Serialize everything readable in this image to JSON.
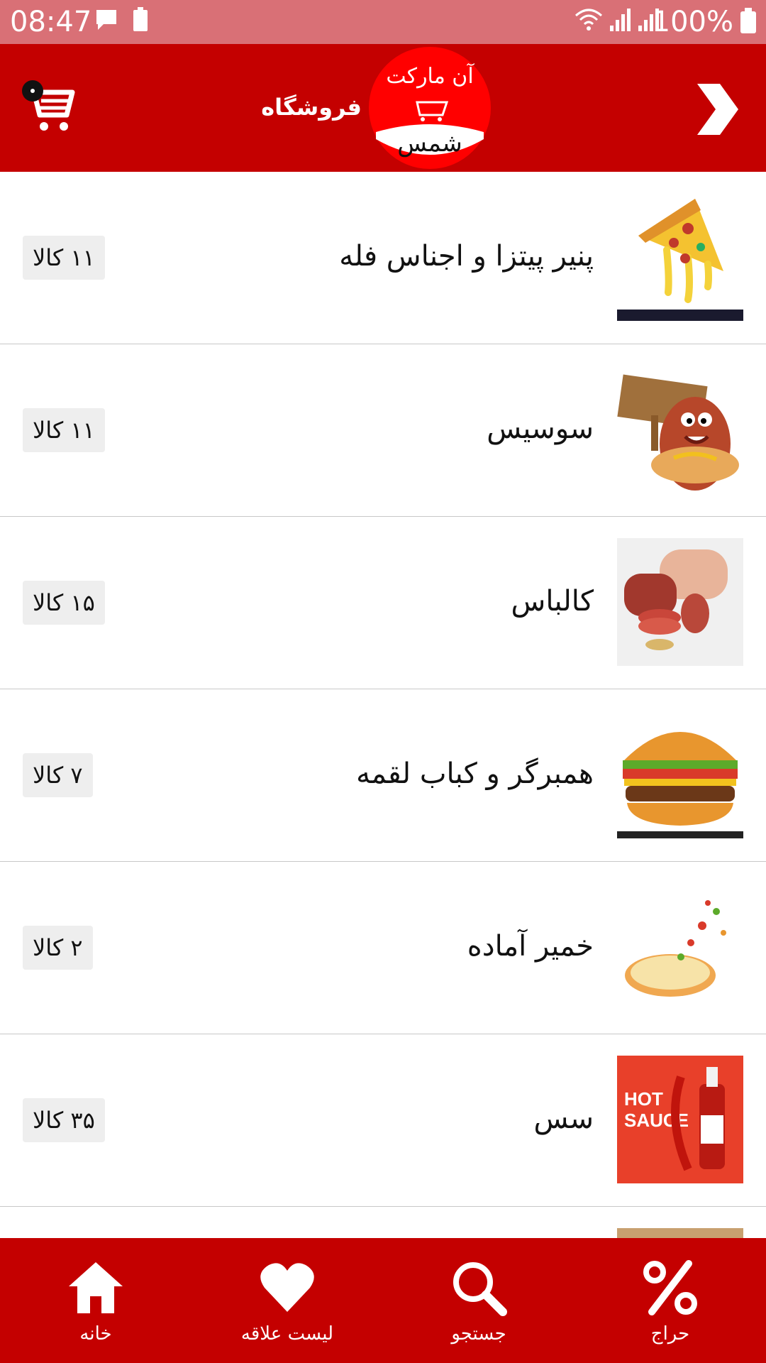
{
  "status_bar": {
    "time": "08:47",
    "battery_percent": "100%",
    "icons": [
      "message-icon",
      "battery-saver-icon",
      "wifi-icon",
      "signal-icon",
      "signal-icon",
      "battery-icon"
    ]
  },
  "header": {
    "title": "فروشگاه",
    "logo_text_top": "آن مارکت",
    "logo_text_bottom": "شمس",
    "cart_icon": "cart-icon",
    "back_icon": "chevron-right-icon",
    "colors": {
      "bar": "#c40000",
      "status_bar": "#d97076",
      "logo": "#ff0000"
    }
  },
  "categories": [
    {
      "name": "پنیر پیتزا و اجناس فله",
      "count": "۱۱ کالا",
      "image": "pizza-slice-image"
    },
    {
      "name": "سوسیس",
      "count": "۱۱ کالا",
      "image": "hotdog-image"
    },
    {
      "name": "کالباس",
      "count": "۱۵ کالا",
      "image": "salami-image"
    },
    {
      "name": "همبرگر و کباب لقمه",
      "count": "۷ کالا",
      "image": "burger-image"
    },
    {
      "name": "خمیر آماده",
      "count": "۲ کالا",
      "image": "pizza-dough-image"
    },
    {
      "name": "سس",
      "count": "۳۵ کالا",
      "image": "hot-sauce-image"
    }
  ],
  "bottom_nav": {
    "home": "خانه",
    "wishlist": "لیست علاقه",
    "search": "جستجو",
    "sale": "حراج"
  }
}
